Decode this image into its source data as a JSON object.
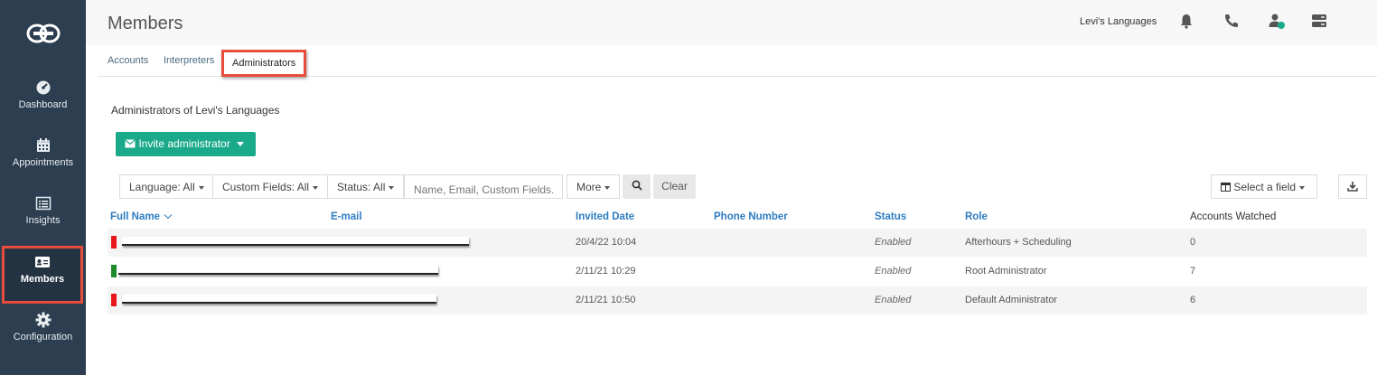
{
  "sidebar": {
    "logo_icon": "logo-icon",
    "items": [
      {
        "label": "Dashboard",
        "icon": "dashboard-icon"
      },
      {
        "label": "Appointments",
        "icon": "calendar-icon"
      },
      {
        "label": "Insights",
        "icon": "insights-icon"
      },
      {
        "label": "Members",
        "icon": "id-card-icon",
        "active": true
      },
      {
        "label": "Configuration",
        "icon": "gear-icon"
      }
    ]
  },
  "header": {
    "title": "Members",
    "org_name": "Levi's Languages",
    "icons": [
      "bell-icon",
      "phone-icon",
      "user-status-icon",
      "server-icon"
    ],
    "status_color": "#1aaa8a"
  },
  "tabs": [
    {
      "label": "Accounts"
    },
    {
      "label": "Interpreters"
    },
    {
      "label": "Administrators",
      "active": true
    }
  ],
  "main": {
    "heading": "Administrators of Levi's Languages",
    "invite_button": "Invite administrator"
  },
  "filters": {
    "language": "Language: All",
    "custom_fields": "Custom Fields: All",
    "status": "Status: All",
    "search_placeholder": "Name, Email, Custom Fields...",
    "more": "More",
    "clear": "Clear",
    "select_field": "Select a field"
  },
  "table": {
    "columns": [
      "Full Name",
      "E-mail",
      "Invited Date",
      "Phone Number",
      "Status",
      "Role",
      "Accounts Watched"
    ],
    "rows": [
      {
        "flag_color": "#e8161b",
        "invited": "20/4/22 10:04",
        "phone": "",
        "status": "Enabled",
        "role": "Afterhours + Scheduling",
        "watched": "0"
      },
      {
        "flag_color": "#1a8a2a",
        "invited": "2/11/21 10:29",
        "phone": "",
        "status": "Enabled",
        "role": "Root Administrator",
        "watched": "7"
      },
      {
        "flag_color": "#e8161b",
        "invited": "2/11/21 10:50",
        "phone": "",
        "status": "Enabled",
        "role": "Default Administrator",
        "watched": "6"
      }
    ]
  },
  "colors": {
    "accent": "#1aaa8a",
    "link": "#2d7cc1",
    "sidebar": "#2c3e50",
    "highlight": "#e74c3c"
  }
}
